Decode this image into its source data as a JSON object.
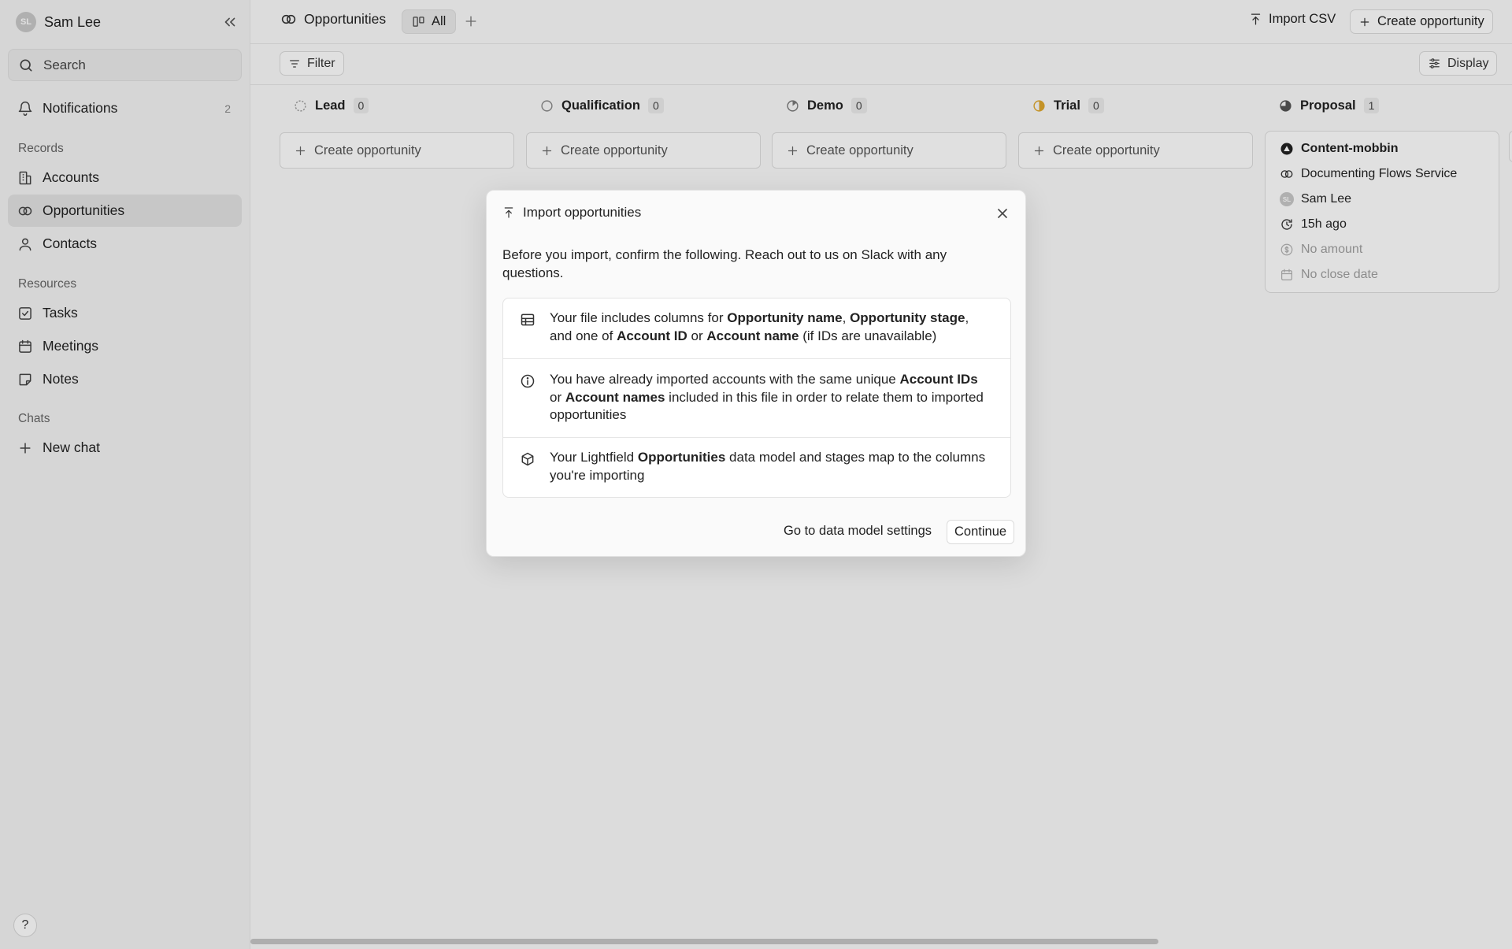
{
  "sidebar": {
    "user": {
      "initials": "SL",
      "name": "Sam Lee"
    },
    "search": {
      "placeholder": "Search"
    },
    "notifications": {
      "label": "Notifications",
      "count": "2"
    },
    "sections": {
      "records": "Records",
      "resources": "Resources",
      "chats": "Chats"
    },
    "records_items": [
      {
        "label": "Accounts",
        "icon": "building-icon"
      },
      {
        "label": "Opportunities",
        "icon": "rings-icon"
      },
      {
        "label": "Contacts",
        "icon": "person-icon"
      }
    ],
    "resources_items": [
      {
        "label": "Tasks",
        "icon": "checkbox-icon"
      },
      {
        "label": "Meetings",
        "icon": "calendar-icon"
      },
      {
        "label": "Notes",
        "icon": "note-icon"
      }
    ],
    "new_chat": "New chat",
    "help": "?"
  },
  "topbar": {
    "title": "Opportunities",
    "tab_all": "All",
    "import_csv": "Import CSV",
    "create_opportunity": "Create opportunity"
  },
  "filterbar": {
    "filter": "Filter",
    "display": "Display"
  },
  "board": {
    "columns": [
      {
        "name": "Lead",
        "count": "0",
        "create": "Create opportunity",
        "color": "#9a9a9a"
      },
      {
        "name": "Qualification",
        "count": "0",
        "create": "Create opportunity",
        "color": "#8a8a8a"
      },
      {
        "name": "Demo",
        "count": "0",
        "create": "Create opportunity",
        "color": "#7a7a7a"
      },
      {
        "name": "Trial",
        "count": "0",
        "create": "Create opportunity",
        "color": "#e0a82e"
      },
      {
        "name": "Proposal",
        "count": "1",
        "create": "",
        "color": "#555555"
      }
    ],
    "card": {
      "account": "Content-mobbin",
      "opportunity": "Documenting Flows Service",
      "owner_initials": "SL",
      "owner": "Sam Lee",
      "updated": "15h ago",
      "amount": "No amount",
      "close_date": "No close date"
    }
  },
  "modal": {
    "title": "Import opportunities",
    "intro": "Before you import, confirm the following. Reach out to us on Slack with any questions.",
    "items": [
      {
        "icon": "table-icon",
        "t1": "Your file includes columns for ",
        "b1": "Opportunity name",
        "t2": ", ",
        "b2": "Opportunity stage",
        "t3": ", and one of ",
        "b3": "Account ID",
        "t4": " or ",
        "b4": "Account name",
        "t5": " (if IDs are unavailable)"
      },
      {
        "icon": "info-icon",
        "t1": "You have already imported accounts with the same unique ",
        "b1": "Account IDs",
        "t2": " or ",
        "b2": "Account names",
        "t3": " included in this file in order to relate them to imported opportunities"
      },
      {
        "icon": "cube-icon",
        "t1": "Your Lightfield ",
        "b1": "Opportunities",
        "t2": " data model and stages map to the columns you're importing"
      }
    ],
    "settings_link": "Go to data model settings",
    "continue": "Continue"
  }
}
